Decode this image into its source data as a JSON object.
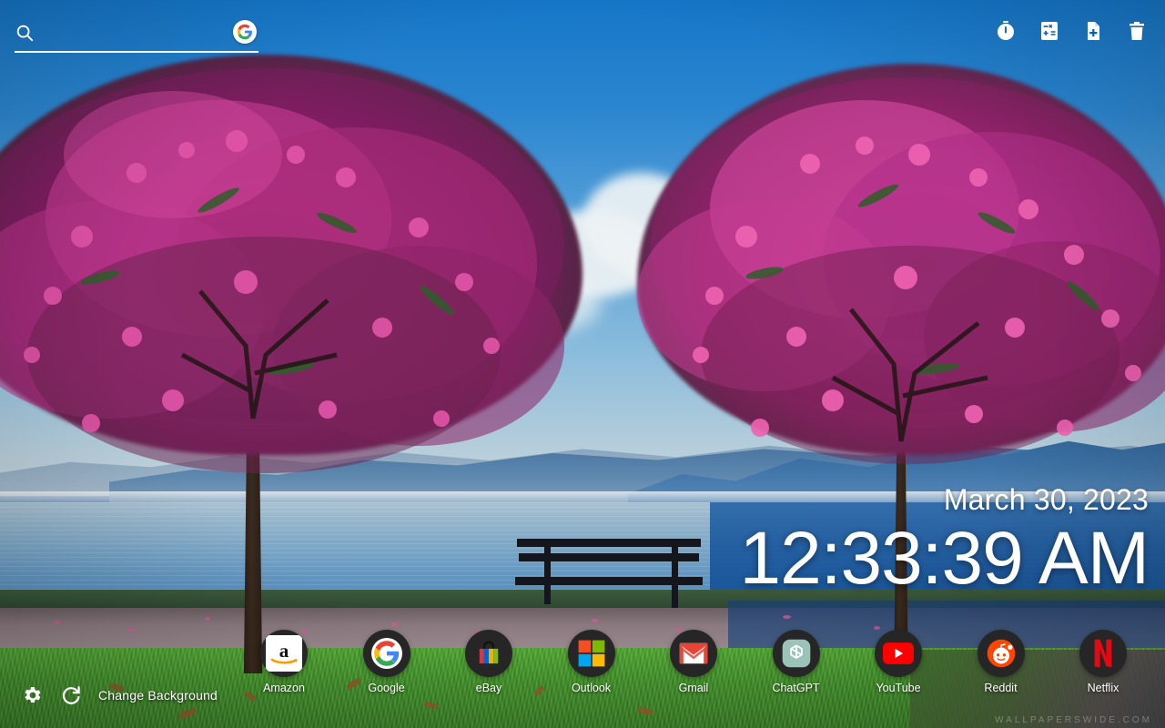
{
  "search": {
    "placeholder": "",
    "value": "",
    "icon": "search-icon",
    "engine_icon": "google-g-icon",
    "engine": "Google"
  },
  "toolbar": {
    "items": [
      {
        "name": "stopwatch",
        "label": "Stopwatch",
        "icon": "stopwatch-icon"
      },
      {
        "name": "calculator",
        "label": "Calculator",
        "icon": "calculator-icon"
      },
      {
        "name": "new-note",
        "label": "New Note",
        "icon": "note-add-icon"
      },
      {
        "name": "trash",
        "label": "Trash",
        "icon": "trash-icon"
      }
    ]
  },
  "clock": {
    "date": "March 30, 2023",
    "time": "12:33:39 AM"
  },
  "shortcuts": [
    {
      "label": "Amazon",
      "icon": "amazon-icon",
      "color": "#FF9900"
    },
    {
      "label": "Google",
      "icon": "google-icon",
      "color": "#4285F4"
    },
    {
      "label": "eBay",
      "icon": "ebay-icon",
      "color": "#E53238"
    },
    {
      "label": "Outlook",
      "icon": "outlook-icon",
      "color": "#0078D4"
    },
    {
      "label": "Gmail",
      "icon": "gmail-icon",
      "color": "#EA4335"
    },
    {
      "label": "ChatGPT",
      "icon": "chatgpt-icon",
      "color": "#74AA9C"
    },
    {
      "label": "YouTube",
      "icon": "youtube-icon",
      "color": "#FF0000"
    },
    {
      "label": "Reddit",
      "icon": "reddit-icon",
      "color": "#FF4500"
    },
    {
      "label": "Netflix",
      "icon": "netflix-icon",
      "color": "#E50914"
    }
  ],
  "footer": {
    "settings_icon": "gear-icon",
    "refresh_icon": "refresh-icon",
    "change_background_label": "Change Background"
  },
  "watermark": "WALLPAPERSWIDE.COM",
  "colors": {
    "icon_tile": "#262626",
    "overlay_text": "#FFFFFF",
    "sky": "#2b86d0",
    "blossom": "#c0398f",
    "grass": "#4fa830",
    "toolbar_bg": "#0b5bbd"
  }
}
